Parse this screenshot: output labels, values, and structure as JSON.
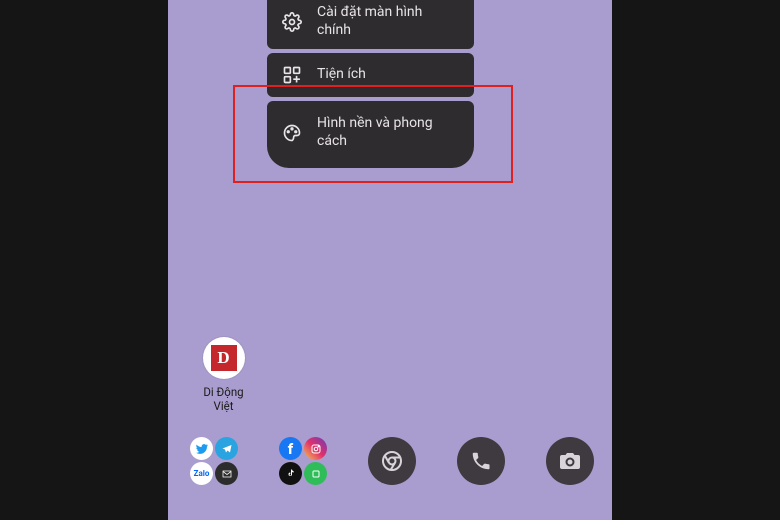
{
  "menu": {
    "items": [
      {
        "label": "Cài đặt màn hình chính"
      },
      {
        "label": "Tiện ích"
      },
      {
        "label": "Hình nền và phong cách"
      }
    ]
  },
  "shortcut": {
    "label": "Di Động Việt",
    "glyph": "D"
  },
  "folders": [
    {
      "apps": [
        {
          "name": "twitter",
          "bg": "#ffffff"
        },
        {
          "name": "telegram",
          "bg": "#2aa4e0"
        },
        {
          "name": "zalo",
          "bg": "#ffffff"
        },
        {
          "name": "gmail",
          "bg": "#2c2c2c"
        }
      ]
    },
    {
      "apps": [
        {
          "name": "facebook",
          "bg": "#1877f2"
        },
        {
          "name": "instagram",
          "bg": "linear-gradient(45deg,#f6c34f,#e1306c,#6a3ab9)"
        },
        {
          "name": "tiktok",
          "bg": "#111111"
        },
        {
          "name": "line",
          "bg": "#2ebd59"
        }
      ]
    }
  ],
  "dock": {
    "chrome_label": "chrome-icon",
    "phone_label": "phone-icon",
    "camera_label": "camera-icon"
  }
}
